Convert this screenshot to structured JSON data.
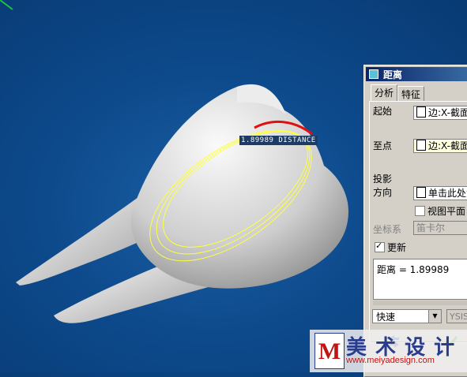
{
  "dialog": {
    "title": "距离",
    "tabs": [
      {
        "label": "分析",
        "active": true
      },
      {
        "label": "特征",
        "active": false
      }
    ],
    "from": {
      "label": "起始",
      "value": "边:X-截面"
    },
    "to": {
      "label": "至点",
      "value": "边:X-截面"
    },
    "projection": {
      "label_line1": "投影",
      "label_line2": "方向",
      "value": "单击此处添",
      "view_plane_label": "视图平面",
      "view_plane_checked": false
    },
    "coord_sys": {
      "label": "坐标系",
      "value": "笛卡尔"
    },
    "update": {
      "label": "更新",
      "checked": true
    },
    "result_text": "距离 = 1.89989",
    "mode_select": {
      "value": "快速"
    },
    "second_select": {
      "value": "YSIS"
    }
  },
  "viewport": {
    "distance_tag": "1.89989  DISTANCE",
    "colors": {
      "background": "#0d4a8c",
      "section_curve": "#ffff40",
      "edge_highlight": "#e01010",
      "model": "#d9d9d9"
    }
  },
  "watermark": {
    "logo_letter": "M",
    "name_cn": "美 术 设 计",
    "url": "www.meiyadesign.com"
  },
  "icons": [
    "window-icon",
    "combo-dropdown-icon",
    "swap-icon",
    "ok-check-icon"
  ]
}
